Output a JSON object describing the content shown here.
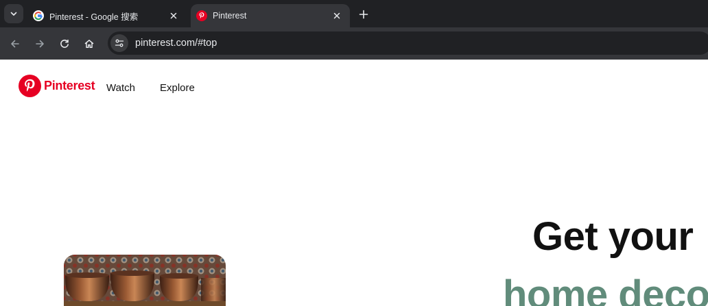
{
  "browser": {
    "tabs": [
      {
        "title": "Pinterest - Google 搜索",
        "favicon": "google-favicon",
        "active": false
      },
      {
        "title": "Pinterest",
        "favicon": "pinterest-favicon",
        "active": true
      }
    ],
    "url": "pinterest.com/#top"
  },
  "header": {
    "logo_text": "Pinterest",
    "nav": {
      "watch": "Watch",
      "explore": "Explore"
    }
  },
  "hero": {
    "line1": "Get your ",
    "line2": "home deco"
  },
  "colors": {
    "brand_red": "#e60023",
    "hero_accent": "#618c7b",
    "chrome_dark": "#202124",
    "chrome_mid": "#35363a"
  }
}
